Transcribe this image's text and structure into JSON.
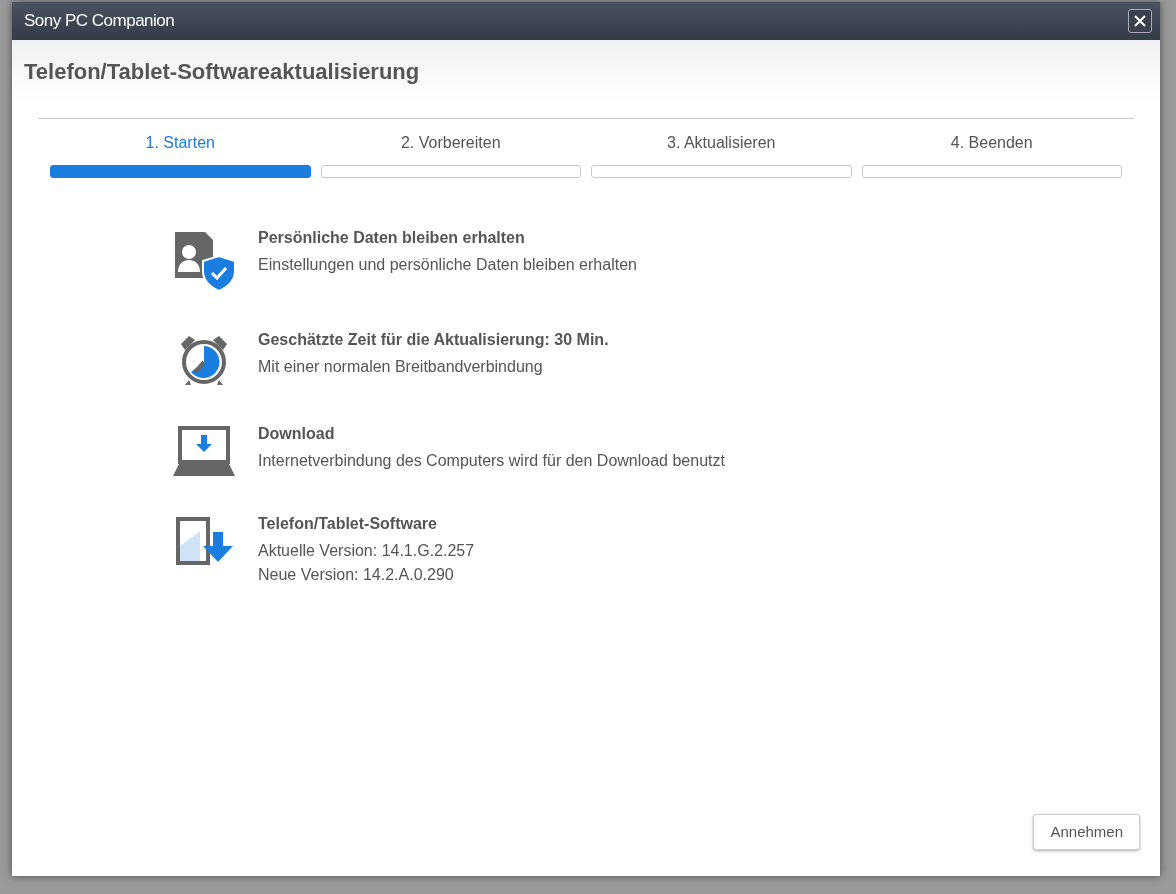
{
  "window": {
    "title": "Sony PC Companion"
  },
  "header": {
    "title": "Telefon/Tablet-Softwareaktualisierung"
  },
  "steps": [
    {
      "label": "1. Starten",
      "selected": true
    },
    {
      "label": "2. Vorbereiten",
      "selected": false
    },
    {
      "label": "3. Aktualisieren",
      "selected": false
    },
    {
      "label": "4. Beenden",
      "selected": false
    }
  ],
  "items": [
    {
      "kind": "data",
      "title": "Persönliche Daten bleiben erhalten",
      "lines": [
        "Einstellungen und persönliche Daten bleiben erhalten"
      ]
    },
    {
      "kind": "time",
      "title": "Geschätzte Zeit für die Aktualisierung: 30 Min.",
      "lines": [
        "Mit einer normalen Breitbandverbindung"
      ]
    },
    {
      "kind": "download",
      "title": "Download",
      "lines": [
        "Internetverbindung des Computers wird für den Download benutzt"
      ]
    },
    {
      "kind": "software",
      "title": "Telefon/Tablet-Software",
      "lines": [
        "Aktuelle Version: 14.1.G.2.257",
        "Neue Version: 14.2.A.0.290"
      ]
    }
  ],
  "footer": {
    "button": "Annehmen"
  }
}
